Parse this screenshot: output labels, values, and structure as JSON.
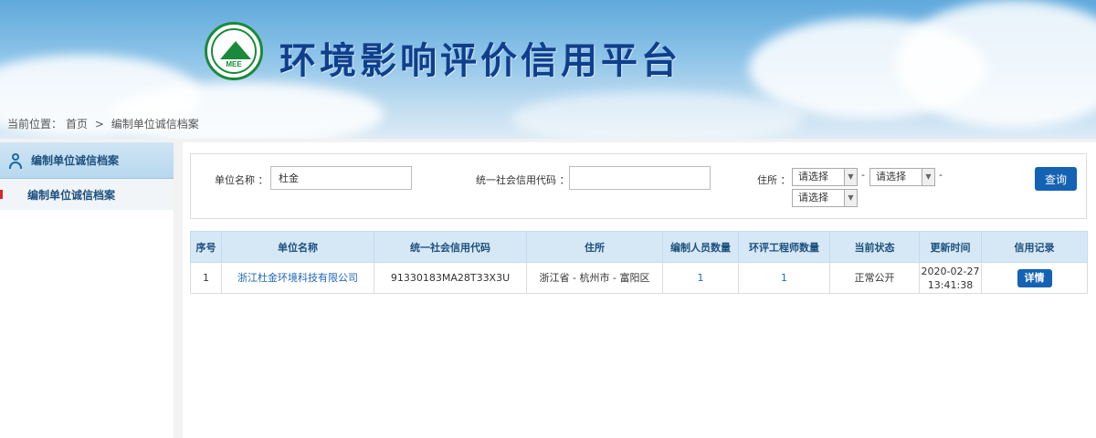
{
  "header": {
    "logo_text": "MEE",
    "title": "环境影响评价信用平台"
  },
  "breadcrumb": {
    "prefix": "当前位置：",
    "home": "首页",
    "separator": ">",
    "current": "编制单位诚信档案"
  },
  "sidebar": {
    "heading": "编制单位诚信档案",
    "items": [
      {
        "label": "编制单位诚信档案",
        "active": true
      }
    ]
  },
  "search": {
    "unit_name_label": "单位名称 ：",
    "unit_name_value": "杜金",
    "credit_code_label": "统一社会信用代码 ：",
    "credit_code_value": "",
    "address_label": "住所 ：",
    "province_select": "请选择",
    "city_select": "请选择",
    "district_select": "请选择",
    "dash": "-",
    "query_button": "查询"
  },
  "table": {
    "columns": [
      "序号",
      "单位名称",
      "统一社会信用代码",
      "住所",
      "编制人员数量",
      "环评工程师数量",
      "当前状态",
      "更新时间",
      "信用记录"
    ],
    "rows": [
      {
        "index": "1",
        "name": "浙江杜金环境科技有限公司",
        "credit_code": "91330183MA28T33X3U",
        "address": "浙江省 - 杭州市 - 富阳区",
        "staff_count": "1",
        "engineer_count": "1",
        "status": "正常公开",
        "update_date": "2020-02-27",
        "update_time": "13:41:38",
        "detail_button": "详情"
      }
    ]
  },
  "colors": {
    "title": "#0f3f8c",
    "logo_green": "#1a8a3a",
    "button_blue": "#1462b4",
    "link_blue": "#1e66b8",
    "table_header_bg": "#d6e8f5",
    "active_marker": "#d9262e"
  }
}
